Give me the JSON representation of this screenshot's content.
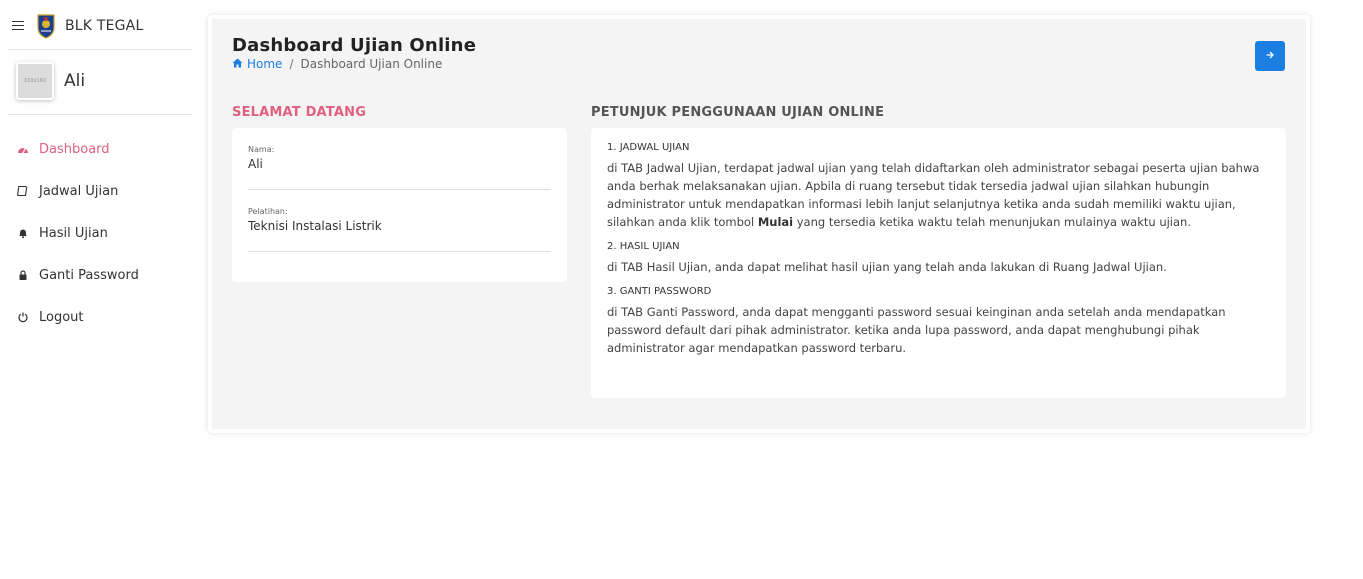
{
  "brand": {
    "name": "BLK TEGAL"
  },
  "user": {
    "name": "Ali",
    "avatar_text": "160x160"
  },
  "menu": [
    {
      "label": "Dashboard",
      "icon": "tachometer-icon",
      "active": true
    },
    {
      "label": "Jadwal Ujian",
      "icon": "book-icon",
      "active": false
    },
    {
      "label": "Hasil Ujian",
      "icon": "bell-icon",
      "active": false
    },
    {
      "label": "Ganti Password",
      "icon": "lock-icon",
      "active": false
    },
    {
      "label": "Logout",
      "icon": "power-icon",
      "active": false
    }
  ],
  "header": {
    "title": "Dashboard Ujian Online",
    "breadcrumb_home": "Home",
    "breadcrumb_current": "Dashboard Ujian Online"
  },
  "welcome": {
    "heading": "SELAMAT DATANG",
    "fields": [
      {
        "label": "Nama:",
        "value": "Ali"
      },
      {
        "label": "Pelatihan:",
        "value": "Teknisi Instalasi Listrik"
      }
    ]
  },
  "guide": {
    "heading": "PETUNJUK PENGGUNAAN UJIAN ONLINE",
    "sections": [
      {
        "title": "1. JADWAL UJIAN",
        "text_before": "di TAB Jadwal Ujian, terdapat jadwal ujian yang telah didaftarkan oleh administrator sebagai peserta ujian bahwa anda berhak melaksanakan ujian. Apbila di ruang tersebut tidak tersedia jadwal ujian silahkan hubungin administrator untuk mendapatkan informasi lebih lanjut selanjutnya ketika anda sudah memiliki waktu ujian, silahkan anda klik tombol ",
        "bold": "Mulai",
        "text_after": " yang tersedia ketika waktu telah menunjukan mulainya waktu ujian."
      },
      {
        "title": "2. HASIL UJIAN",
        "text": "di TAB Hasil Ujian, anda dapat melihat hasil ujian yang telah anda lakukan di Ruang Jadwal Ujian."
      },
      {
        "title": "3. GANTI PASSWORD",
        "text": "di TAB Ganti Password, anda dapat mengganti password sesuai keinginan anda setelah anda mendapatkan password default dari pihak administrator. ketika anda lupa password, anda dapat menghubungi pihak administrator agar mendapatkan password terbaru."
      }
    ]
  },
  "colors": {
    "accent": "#e06080",
    "primary": "#1a7fe0",
    "panel": "#f4f4f4"
  }
}
